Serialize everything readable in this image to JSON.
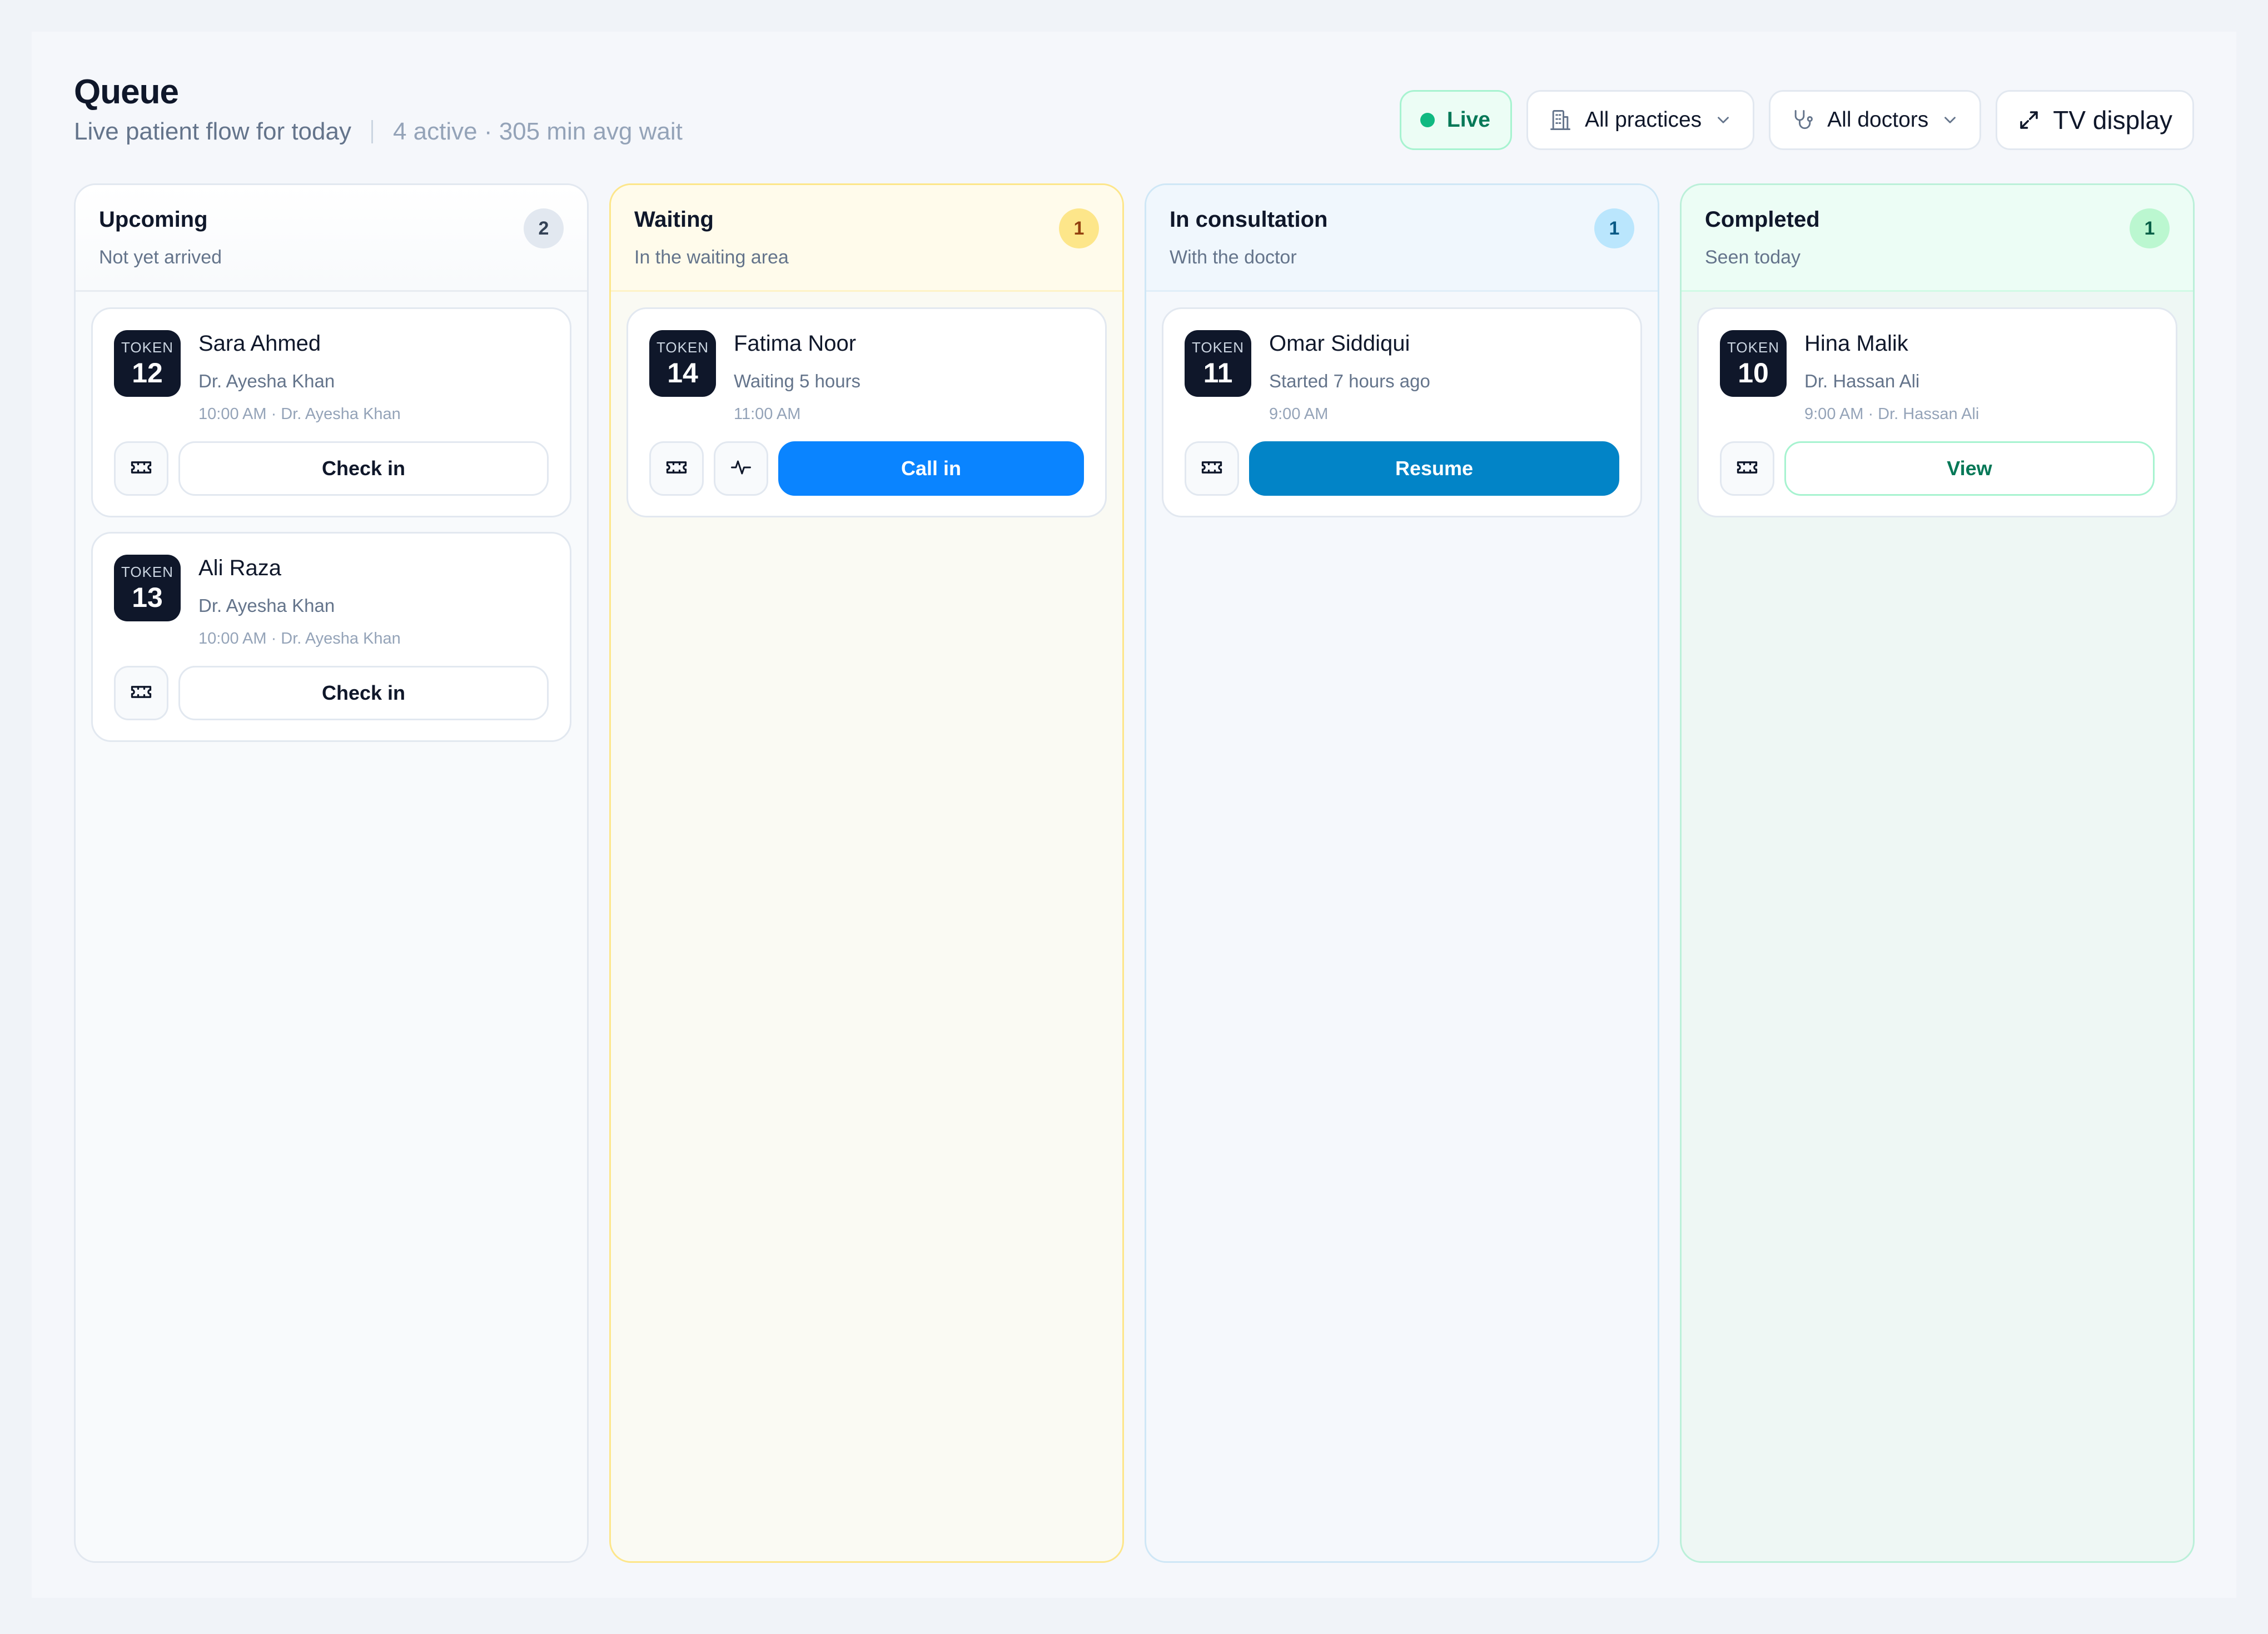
{
  "header": {
    "title": "Queue",
    "subtitle": "Live patient flow for today",
    "stats": "4 active · 305 min avg wait"
  },
  "controls": {
    "live_label": "Live",
    "practices_label": "All practices",
    "doctors_label": "All doctors",
    "tv_label": "TV display"
  },
  "columns": [
    {
      "title": "Upcoming",
      "subtitle": "Not yet arrived",
      "count": "2",
      "cards": [
        {
          "token_label": "TOKEN",
          "token": "12",
          "name": "Sara Ahmed",
          "line2": "Dr. Ayesha Khan",
          "line3": "10:00 AM · Dr. Ayesha Khan",
          "action": "Check in"
        },
        {
          "token_label": "TOKEN",
          "token": "13",
          "name": "Ali Raza",
          "line2": "Dr. Ayesha Khan",
          "line3": "10:00 AM · Dr. Ayesha Khan",
          "action": "Check in"
        }
      ]
    },
    {
      "title": "Waiting",
      "subtitle": "In the waiting area",
      "count": "1",
      "cards": [
        {
          "token_label": "TOKEN",
          "token": "14",
          "name": "Fatima Noor",
          "line2": "Waiting 5 hours",
          "line3": "11:00 AM",
          "action": "Call in"
        }
      ]
    },
    {
      "title": "In consultation",
      "subtitle": "With the doctor",
      "count": "1",
      "cards": [
        {
          "token_label": "TOKEN",
          "token": "11",
          "name": "Omar Siddiqui",
          "line2": "Started 7 hours ago",
          "line3": "9:00 AM",
          "action": "Resume"
        }
      ]
    },
    {
      "title": "Completed",
      "subtitle": "Seen today",
      "count": "1",
      "cards": [
        {
          "token_label": "TOKEN",
          "token": "10",
          "name": "Hina Malik",
          "line2": "Dr. Hassan Ali",
          "line3": "9:00 AM · Dr. Hassan Ali",
          "action": "View"
        }
      ]
    }
  ],
  "icons": {
    "live": "status-dot-icon",
    "practices": "building-icon",
    "doctors": "stethoscope-icon",
    "tv": "expand-icon",
    "ticket": "ticket-icon",
    "vitals": "activity-icon",
    "dropdown": "chevron-down-icon"
  },
  "colors": {
    "live_green": "#10b981",
    "call_in_blue": "#0a84ff",
    "resume_blue": "#0284c7",
    "token_bg": "#0f172a",
    "waiting_badge": "#fde68a",
    "consult_badge": "#bae6fd",
    "completed_badge": "#bbf7d0"
  }
}
